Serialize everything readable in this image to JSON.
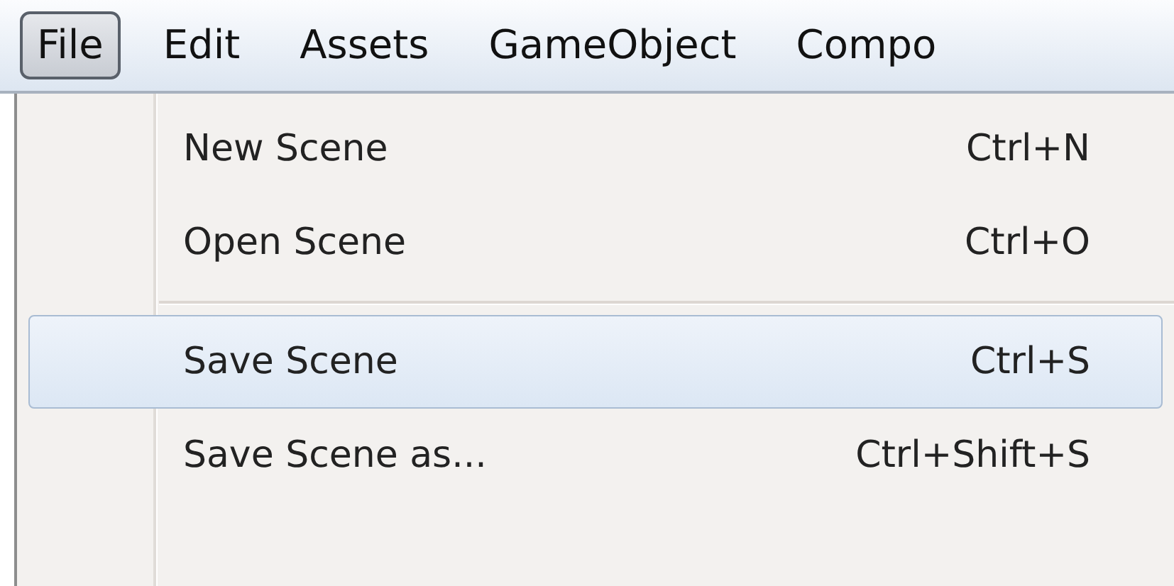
{
  "menubar": [
    {
      "label": "File",
      "selected": true
    },
    {
      "label": "Edit",
      "selected": false
    },
    {
      "label": "Assets",
      "selected": false
    },
    {
      "label": "GameObject",
      "selected": false
    },
    {
      "label": "Compo",
      "selected": false
    }
  ],
  "menu": {
    "items": [
      {
        "kind": "item",
        "label": "New Scene",
        "shortcut": "Ctrl+N",
        "selected": false
      },
      {
        "kind": "item",
        "label": "Open Scene",
        "shortcut": "Ctrl+O",
        "selected": false
      },
      {
        "kind": "separator"
      },
      {
        "kind": "item",
        "label": "Save Scene",
        "shortcut": "Ctrl+S",
        "selected": true
      },
      {
        "kind": "item",
        "label": "Save Scene as...",
        "shortcut": "Ctrl+Shift+S",
        "selected": false
      }
    ]
  }
}
